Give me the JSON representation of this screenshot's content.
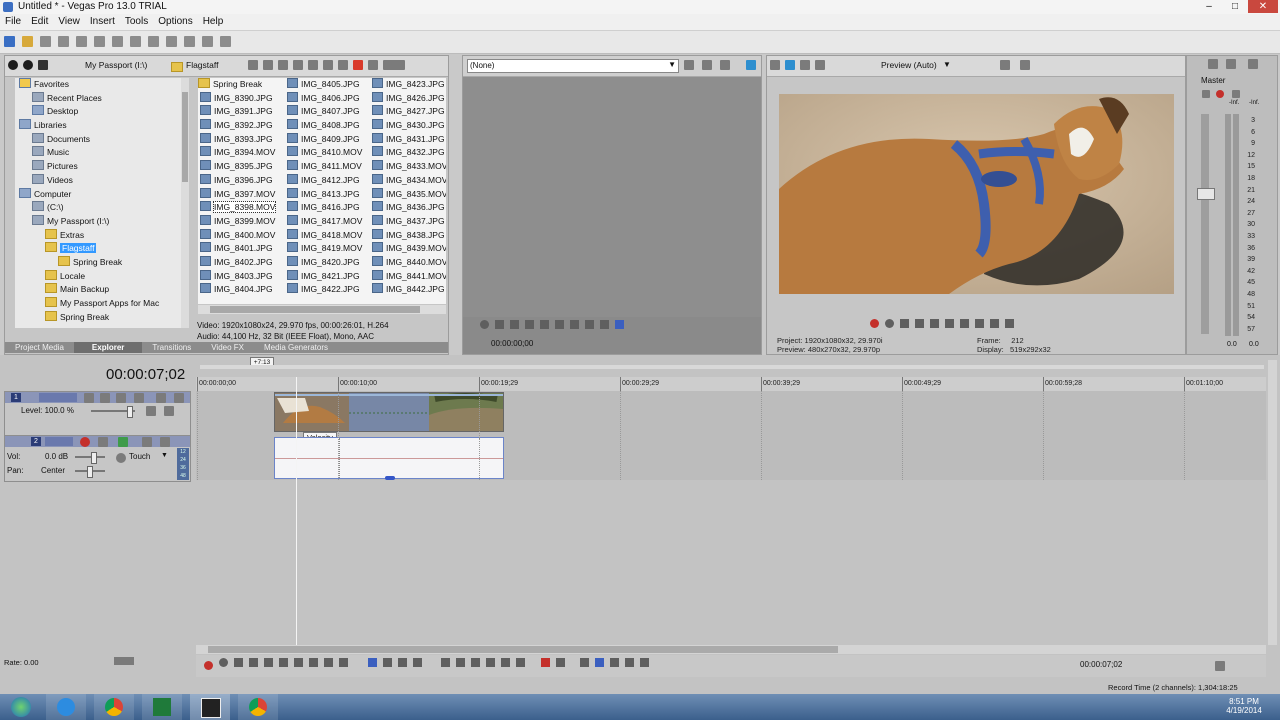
{
  "window": {
    "title": "Untitled * - Vegas Pro 13.0 TRIAL"
  },
  "menu": [
    "File",
    "Edit",
    "View",
    "Insert",
    "Tools",
    "Options",
    "Help"
  ],
  "explorer": {
    "path_segments": [
      "My Passport (I:\\)",
      "Flagstaff"
    ],
    "tree": [
      {
        "label": "Favorites",
        "indent": 0,
        "icon": "star"
      },
      {
        "label": "Recent Places",
        "indent": 1,
        "icon": "folder-gray"
      },
      {
        "label": "Desktop",
        "indent": 1,
        "icon": "folder-blue"
      },
      {
        "label": "Libraries",
        "indent": 0,
        "icon": "folder-blue"
      },
      {
        "label": "Documents",
        "indent": 1,
        "icon": "folder-gray"
      },
      {
        "label": "Music",
        "indent": 1,
        "icon": "folder-gray"
      },
      {
        "label": "Pictures",
        "indent": 1,
        "icon": "folder-gray"
      },
      {
        "label": "Videos",
        "indent": 1,
        "icon": "folder-gray"
      },
      {
        "label": "Computer",
        "indent": 0,
        "icon": "folder-blue"
      },
      {
        "label": "(C:\\)",
        "indent": 1,
        "icon": "folder-gray"
      },
      {
        "label": "My Passport (I:\\)",
        "indent": 1,
        "icon": "folder-gray"
      },
      {
        "label": "Extras",
        "indent": 2,
        "icon": "folder"
      },
      {
        "label": "Flagstaff",
        "indent": 2,
        "icon": "folder",
        "selected": true
      },
      {
        "label": "Spring Break",
        "indent": 3,
        "icon": "folder"
      },
      {
        "label": "Locale",
        "indent": 2,
        "icon": "folder"
      },
      {
        "label": "Main Backup",
        "indent": 2,
        "icon": "folder"
      },
      {
        "label": "My Passport Apps for Mac",
        "indent": 2,
        "icon": "folder"
      },
      {
        "label": "Spring Break",
        "indent": 2,
        "icon": "folder"
      }
    ],
    "files_col1": [
      "Spring Break",
      "IMG_8390.JPG",
      "IMG_8391.JPG",
      "IMG_8392.JPG",
      "IMG_8393.JPG",
      "IMG_8394.MOV",
      "IMG_8395.JPG",
      "IMG_8396.JPG",
      "IMG_8397.MOV",
      "IMG_8398.MOV",
      "IMG_8399.MOV",
      "IMG_8400.MOV",
      "IMG_8401.JPG",
      "IMG_8402.JPG",
      "IMG_8403.JPG",
      "IMG_8404.JPG"
    ],
    "files_col2": [
      "IMG_8405.JPG",
      "IMG_8406.JPG",
      "IMG_8407.JPG",
      "IMG_8408.JPG",
      "IMG_8409.JPG",
      "IMG_8410.MOV",
      "IMG_8411.MOV",
      "IMG_8412.JPG",
      "IMG_8413.JPG",
      "IMG_8416.JPG",
      "IMG_8417.MOV",
      "IMG_8418.MOV",
      "IMG_8419.MOV",
      "IMG_8420.JPG",
      "IMG_8421.JPG",
      "IMG_8422.JPG"
    ],
    "files_col3": [
      "IMG_8423.JPG",
      "IMG_8426.JPG",
      "IMG_8427.JPG",
      "IMG_8430.JPG",
      "IMG_8431.JPG",
      "IMG_8432.JPG",
      "IMG_8433.MOV",
      "IMG_8434.MOV",
      "IMG_8435.MOV",
      "IMG_8436.JPG",
      "IMG_8437.JPG",
      "IMG_8438.JPG",
      "IMG_8439.MOV",
      "IMG_8440.MOV",
      "IMG_8441.MOV",
      "IMG_8442.JPG"
    ],
    "selected_file": "IMG_8398.MOV",
    "info_video": "Video: 1920x1080x24, 29.970 fps, 00:00:26:01, H.264",
    "info_audio": "Audio: 44,100 Hz, 32 Bit (IEEE Float), Mono, AAC",
    "tabs": [
      "Project Media",
      "Explorer",
      "Transitions",
      "Video FX",
      "Media Generators"
    ],
    "active_tab": "Explorer"
  },
  "trimmer": {
    "dropdown": "(None)",
    "time": "00:00:00;00"
  },
  "preview": {
    "mode": "Preview (Auto)",
    "project_label": "Project:",
    "project_value": "1920x1080x32, 29.970i",
    "preview_label": "Preview:",
    "preview_value": "480x270x32, 29.970p",
    "frame_label": "Frame:",
    "frame_value": "212",
    "display_label": "Display:",
    "display_value": "519x292x32"
  },
  "master": {
    "label": "Master",
    "inf_left": "-Inf.",
    "inf_right": "-Inf.",
    "scale": [
      "3",
      "6",
      "9",
      "12",
      "15",
      "18",
      "21",
      "24",
      "27",
      "30",
      "33",
      "36",
      "39",
      "42",
      "45",
      "48",
      "51",
      "54",
      "57"
    ],
    "bottom_left": "0.0",
    "bottom_right": "0.0"
  },
  "timeline": {
    "current_time": "00:00:07;02",
    "marker": "+7:13",
    "ruler": [
      "00:00:00;00",
      "00:00:10;00",
      "00:00:19;29",
      "00:00:29;29",
      "00:00:39;29",
      "00:00:49;29",
      "00:00:59;28",
      "00:01:10;00"
    ],
    "video_track": {
      "number": "1",
      "level": "Level: 100.0 %"
    },
    "audio_track": {
      "number": "2",
      "vol": "Vol:",
      "vol_value": "0.0 dB",
      "pan": "Pan:",
      "pan_value": "Center",
      "touch": "Touch",
      "meter": [
        "12",
        "24",
        "36",
        "48"
      ]
    },
    "tooltip": "Velocity",
    "rate": "Rate: 0.00",
    "bottom_time": "00:00:07;02",
    "record_time": "Record Time (2 channels): 1,304:18:25"
  },
  "taskbar": {
    "clock_time": "8:51 PM",
    "clock_date": "4/19/2014"
  }
}
